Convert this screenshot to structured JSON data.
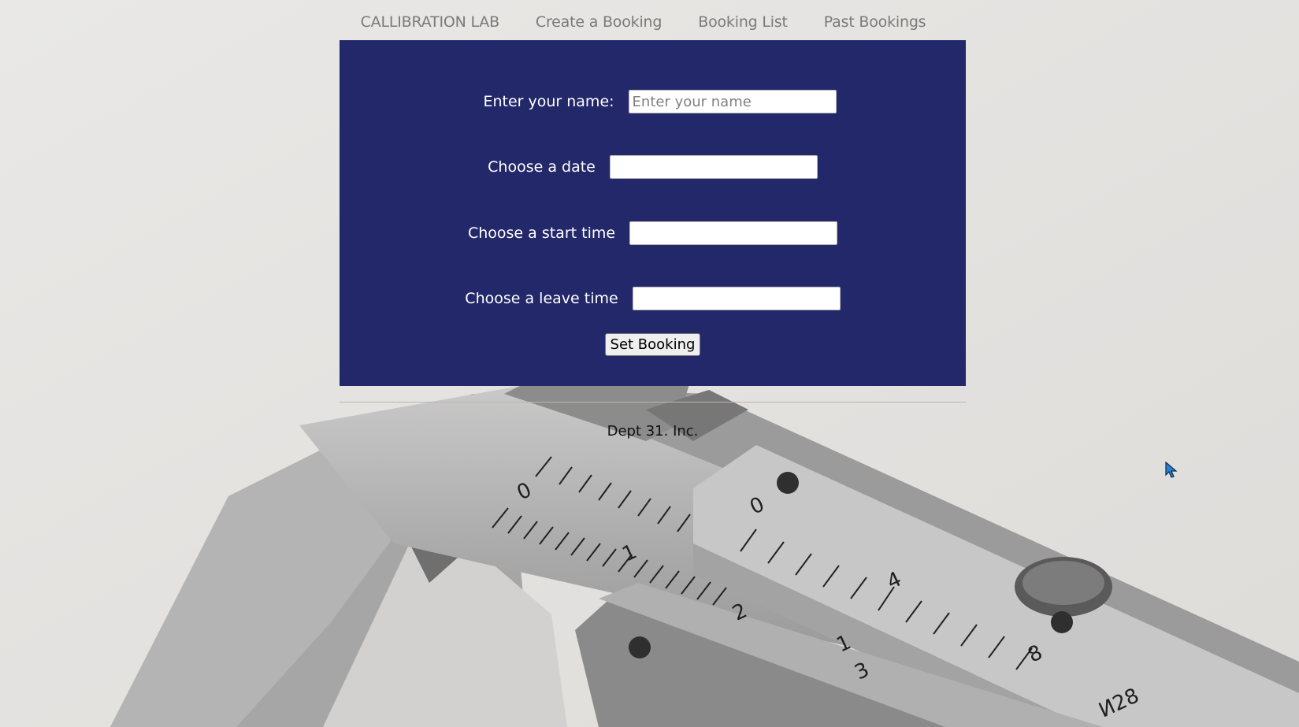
{
  "nav": {
    "brand": "CALLIBRATION LAB",
    "items": [
      "Create a Booking",
      "Booking List",
      "Past Bookings"
    ]
  },
  "form": {
    "name_label": "Enter your name:",
    "name_placeholder": "Enter your name",
    "date_label": "Choose a date",
    "start_label": "Choose a start time",
    "leave_label": "Choose a leave time",
    "submit_label": "Set Booking"
  },
  "footer": {
    "text": "Dept 31. Inc."
  },
  "colors": {
    "panel": "#23286a",
    "page_bg": "#e6e5e3",
    "nav_text": "#7a7a7a"
  },
  "background": {
    "scale_numbers": [
      "0",
      "1",
      "2",
      "0",
      "4",
      "1",
      "3",
      "8",
      "И28"
    ]
  }
}
